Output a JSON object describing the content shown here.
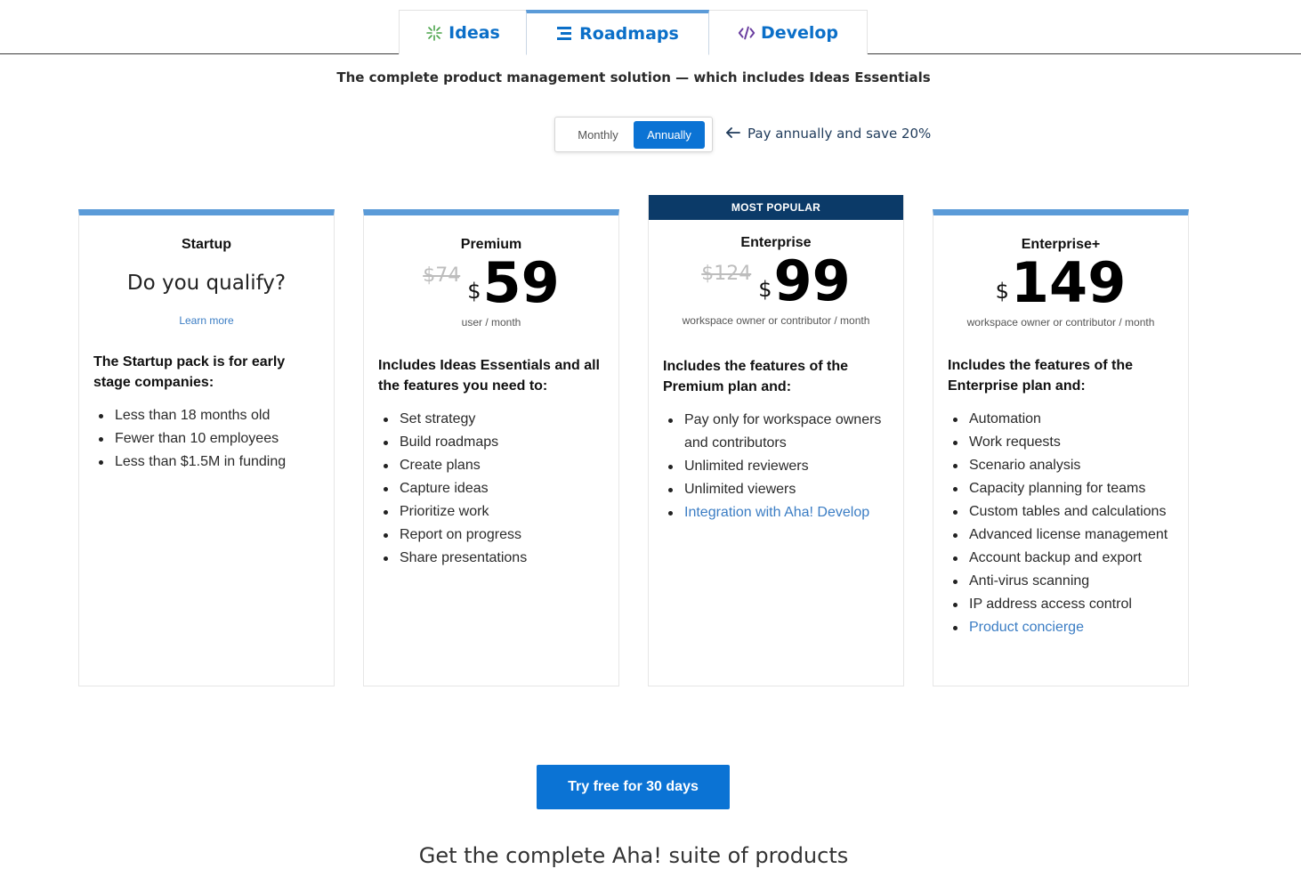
{
  "tabs": [
    {
      "label": "Ideas",
      "icon": "sparkle-icon"
    },
    {
      "label": "Roadmaps",
      "icon": "roadmap-icon"
    },
    {
      "label": "Develop",
      "icon": "code-icon"
    }
  ],
  "subtitle": "The complete product management solution — which includes Ideas Essentials",
  "billing": {
    "monthly_label": "Monthly",
    "annually_label": "Annually",
    "selected": "Annually",
    "save_note": "Pay annually and save 20%"
  },
  "plans": [
    {
      "name": "Startup",
      "qualify": "Do you qualify?",
      "learn_more": "Learn more",
      "description": "The Startup pack is for early stage companies:",
      "features": [
        "Less than 18 months old",
        "Fewer than 10 employees",
        "Less than $1.5M in funding"
      ]
    },
    {
      "name": "Premium",
      "old_price": "$74",
      "currency": "$",
      "price": "59",
      "per": "user / month",
      "description": "Includes Ideas Essentials and all the features you need to:",
      "features": [
        "Set strategy",
        "Build roadmaps",
        "Create plans",
        "Capture ideas",
        "Prioritize work",
        "Report on progress",
        "Share presentations"
      ]
    },
    {
      "badge": "MOST POPULAR",
      "name": "Enterprise",
      "old_price": "$124",
      "currency": "$",
      "price": "99",
      "per": "workspace owner or contributor / month",
      "description": "Includes the features of the Premium plan and:",
      "features": [
        "Pay only for workspace owners and contributors",
        "Unlimited reviewers",
        "Unlimited viewers"
      ],
      "link_feature": "Integration with Aha! Develop"
    },
    {
      "name": "Enterprise+",
      "currency": "$",
      "price": "149",
      "per": "workspace owner or contributor / month",
      "description": "Includes the features of the Enterprise plan and:",
      "features": [
        "Automation",
        "Work requests",
        "Scenario analysis",
        "Capacity planning for teams",
        "Custom tables and calculations",
        "Advanced license management",
        "Account backup and export",
        "Anti-virus scanning",
        "IP address access control"
      ],
      "link_feature": "Product concierge"
    }
  ],
  "cta_label": "Try free for 30 days",
  "suite_heading": "Get the complete Aha! suite of products",
  "colors": {
    "accent": "#0b73d4",
    "tab_text": "#0b6fc8",
    "card_stripe": "#5b9bd8",
    "popular_banner": "#0b3a68",
    "link": "#3b7dc4"
  }
}
